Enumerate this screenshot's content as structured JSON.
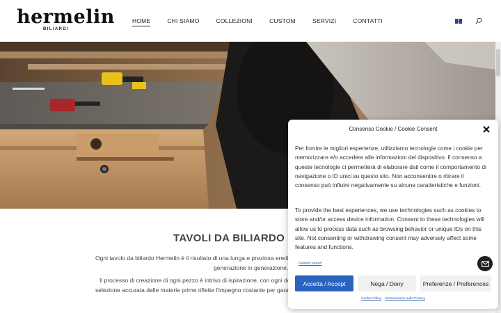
{
  "brand": {
    "name": "hermelin",
    "subtitle": "BILIARDI"
  },
  "nav": {
    "items": [
      {
        "label": "HOME",
        "active": true
      },
      {
        "label": "CHI SIAMO",
        "active": false
      },
      {
        "label": "COLLEZIONI",
        "active": false
      },
      {
        "label": "CUSTOM",
        "active": false
      },
      {
        "label": "SERVIZI",
        "active": false
      },
      {
        "label": "CONTATTI",
        "active": false
      }
    ],
    "language_icon": "uk-flag-icon",
    "search_icon": "search-icon"
  },
  "main": {
    "title": "TAVOLI DA BILIARDO D",
    "paragraph1": [
      "Ogni tavolo da biliardo Hermelin è il risultato di una lunga e preziosa eredità",
      "generazione in generazione."
    ],
    "paragraph2": [
      "Il processo di creazione di ogni pezzo è intriso di ispirazione, con ogni de",
      "selezione accurata delle materie prime riflette l'impegno costante per garan"
    ]
  },
  "cookie": {
    "title": "Consenso Cookie / Cookie Consent",
    "text_it": [
      "Per fornire le migliori esperienze, utilizziamo tecnologie come i cookie per",
      "memorizzare e/o accedere alle informazioni del dispositivo. Il consenso a",
      "queste tecnologie ci permetterà di elaborare dati come il comportamento di",
      "navigazione o ID unici su questo sito. Non acconsentire o ritirare il",
      "consenso può influire negativamente su alcune caratteristiche e funzioni."
    ],
    "text_en": [
      "To provide the best experiences, we use technologies such as cookies to",
      "store and/or access device information. Consent to these technologies will",
      "allow us to process data such as browsing behavior or unique IDs on this",
      "site. Not consenting or withdrawing consent may adversely affect some",
      "features and functions."
    ],
    "manage_link": "Gestisci servizi",
    "accept_label": "Accetta / Accept",
    "deny_label": "Nega / Deny",
    "prefs_label": "Preferenze / Preferences",
    "policy_link": "Cookie Policy",
    "privacy_link": "Dichiarazione sulla Privacy"
  },
  "colors": {
    "accent": "#2a63c0",
    "dark": "#1f1f1f"
  }
}
